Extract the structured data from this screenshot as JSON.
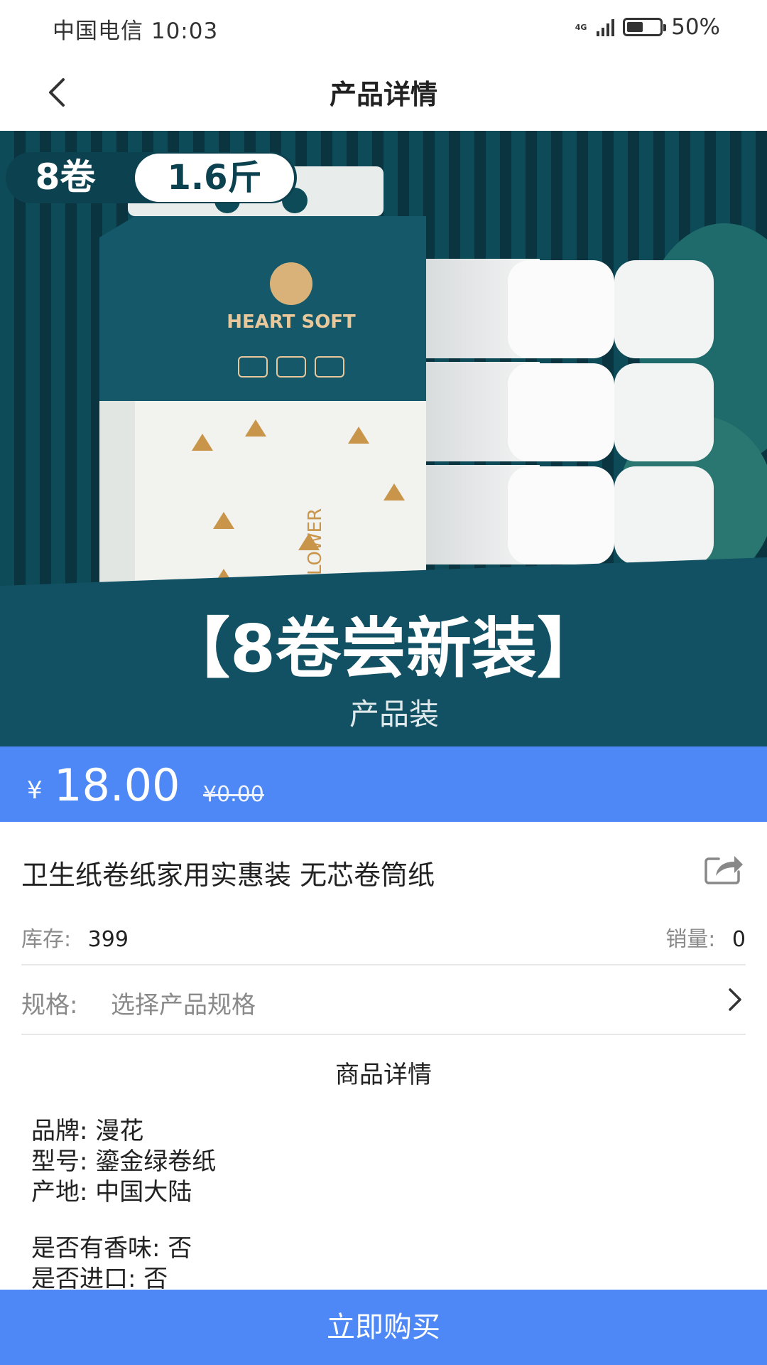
{
  "status_bar": {
    "carrier_time": "中国电信 10:03",
    "network": "4G",
    "battery_percent": "50%",
    "battery_level": 0.5
  },
  "nav": {
    "title": "产品详情",
    "back_icon": "chevron-left-icon"
  },
  "product_image": {
    "badge_rolls": "8卷",
    "badge_weight": "1.6斤",
    "banner_text": "【8卷尝新装】",
    "banner_sub": "产品装",
    "brand_text": "HEART SOFT",
    "pattern_text": "FLOWER"
  },
  "price": {
    "symbol": "¥",
    "current": "18.00",
    "original": "¥0.00"
  },
  "product": {
    "title": "卫生纸卷纸家用实惠装 无芯卷筒纸",
    "share_icon": "share-icon"
  },
  "stats": {
    "stock_label": "库存:",
    "stock_value": "399",
    "sales_label": "销量:",
    "sales_value": "0"
  },
  "spec": {
    "label": "规格:",
    "value": "选择产品规格",
    "arrow_icon": "chevron-right-icon"
  },
  "details": {
    "heading": "商品详情",
    "lines": [
      "品牌:  漫花",
      "型号:  鎏金绿卷纸",
      "产地:  中国大陆",
      "是否有香味:  否",
      "是否进口:  否"
    ]
  },
  "buy_button": {
    "label": "立即购买"
  },
  "colors": {
    "accent": "#4e88f7",
    "teal_dark": "#0f4f5e",
    "teal": "#1a6d7f"
  }
}
